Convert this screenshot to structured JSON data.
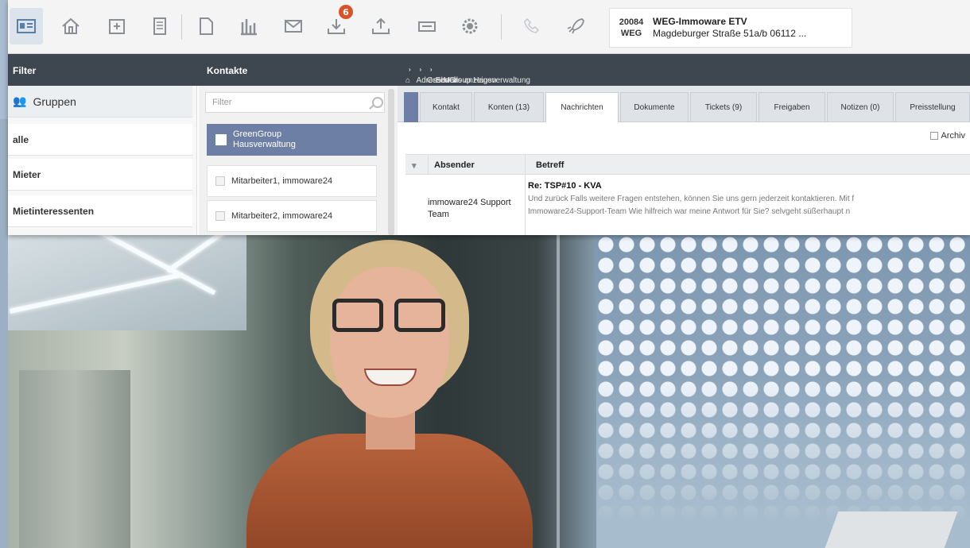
{
  "toolbar": {
    "icons": [
      "contacts-card-icon",
      "home-icon",
      "calendar-icon",
      "document-list-icon",
      "note-icon",
      "chart-icon",
      "mail-icon",
      "inbox-download-icon",
      "upload-icon",
      "ticket-icon",
      "settings-icon",
      "phone-icon",
      "rocket-icon"
    ],
    "badge_count": "6"
  },
  "object": {
    "id": "20084",
    "type": "WEG",
    "name": "WEG-Immoware ETV",
    "address": "Magdeburger Straße 51a/b 06112 ..."
  },
  "headers": {
    "filter": "Filter",
    "contacts": "Kontakte"
  },
  "breadcrumb": [
    "Adressbuch",
    "GreenGroup Hausverwaltung",
    "E-Mails anzeigen"
  ],
  "filter": {
    "groups_label": "Gruppen",
    "items": [
      "alle",
      "Mieter",
      "Mietinteressenten"
    ]
  },
  "contacts": {
    "search_placeholder": "Filter",
    "items": [
      "GreenGroup Hausverwaltung",
      "Mitarbeiter1, immoware24",
      "Mitarbeiter2, immoware24"
    ]
  },
  "tabs": [
    "Kontakt",
    "Konten (13)",
    "Nachrichten",
    "Dokumente",
    "Tickets (9)",
    "Freigaben",
    "Notizen (0)",
    "Preisstellung"
  ],
  "active_tab": "Nachrichten",
  "archive_label": "Archiv",
  "messages": {
    "columns": [
      "Absender",
      "Betreff"
    ],
    "rows": [
      {
        "sender": "immoware24 Support Team",
        "subject": "Re: TSP#10 - KVA",
        "preview1": "Und zurück Falls weitere Fragen entstehen, können Sie uns gern jederzeit kontaktieren. Mit f",
        "preview2": "Immoware24-Support-Team Wie hilfreich war meine Antwort für Sie? selvgeht süßerhaupt n"
      }
    ]
  },
  "colors": {
    "header_bg": "#3e4650",
    "selected_bg": "#6d7fa4",
    "badge": "#d9532a"
  }
}
